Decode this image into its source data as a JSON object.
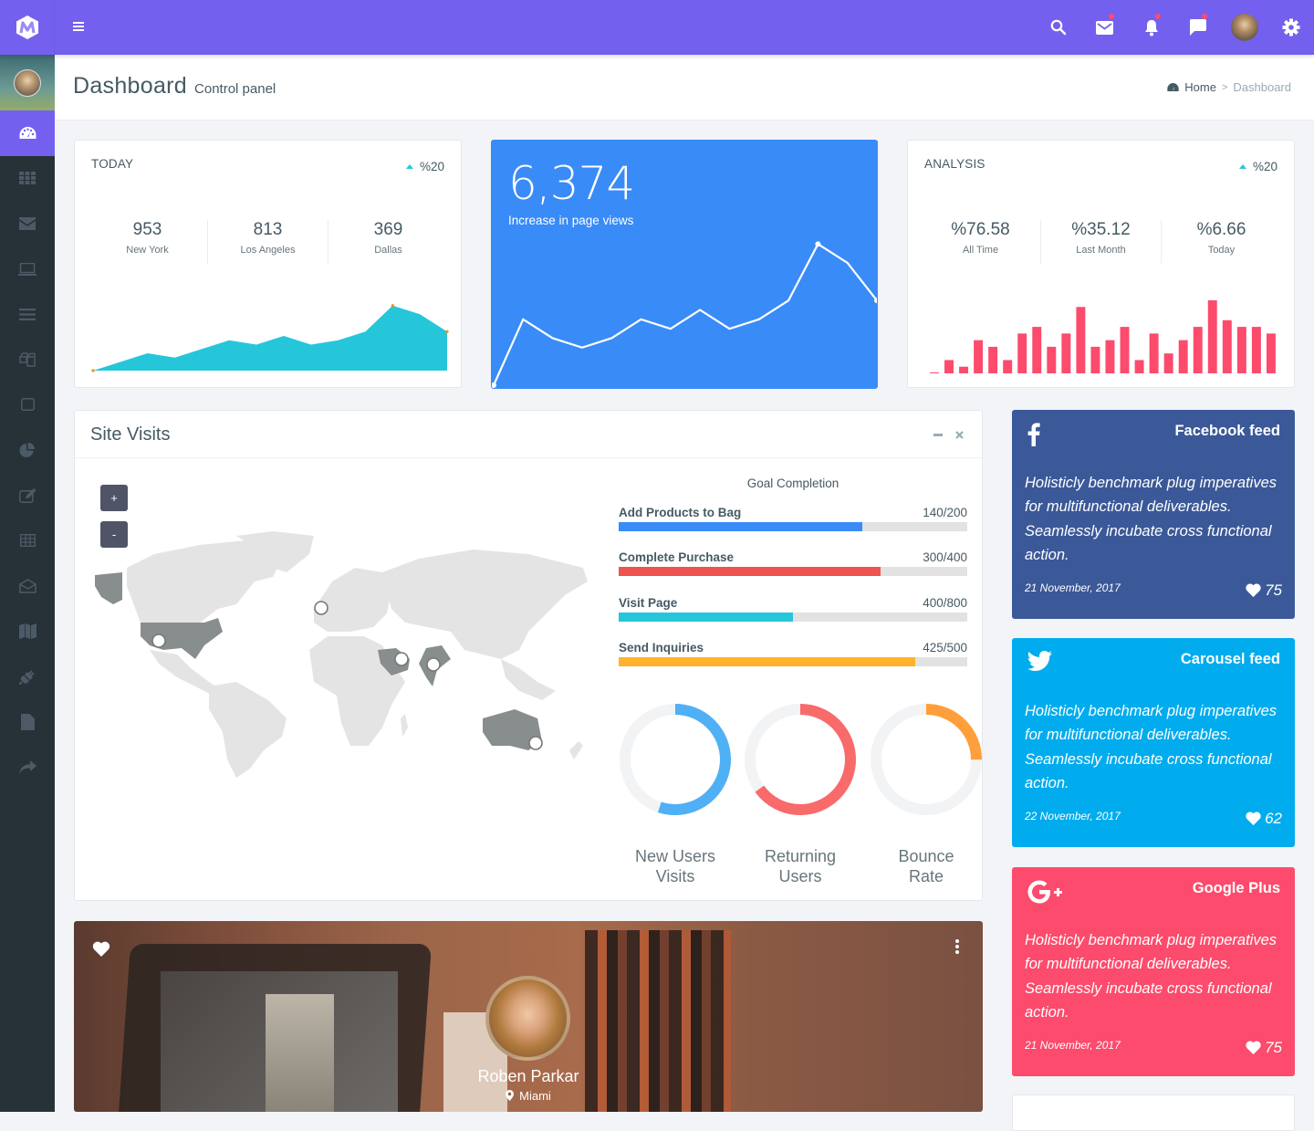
{
  "topbar": {
    "icons": [
      "logo-icon",
      "menu-icon",
      "search-icon",
      "mail-icon",
      "bell-icon",
      "chat-icon",
      "user-avatar",
      "gear-icon"
    ],
    "accent": "#7460ee",
    "badge_color": "#fc4b6c"
  },
  "sidebar": {
    "items": [
      {
        "icon": "dashboard-icon",
        "active": true
      },
      {
        "icon": "apps-grid-icon"
      },
      {
        "icon": "envelope-icon"
      },
      {
        "icon": "laptop-icon"
      },
      {
        "icon": "list-icon"
      },
      {
        "icon": "copy-icon"
      },
      {
        "icon": "square-icon"
      },
      {
        "icon": "pie-chart-icon"
      },
      {
        "icon": "edit-icon"
      },
      {
        "icon": "table-icon"
      },
      {
        "icon": "envelope-open-icon"
      },
      {
        "icon": "map-icon"
      },
      {
        "icon": "plug-icon"
      },
      {
        "icon": "file-icon"
      },
      {
        "icon": "share-icon"
      }
    ]
  },
  "header": {
    "title": "Dashboard",
    "subtitle": "Control panel",
    "breadcrumb": {
      "home": "Home",
      "separator": ">",
      "current": "Dashboard"
    }
  },
  "today_card": {
    "title": "TODAY",
    "trend": "%20",
    "stats": [
      {
        "value": "953",
        "label": "New York"
      },
      {
        "value": "813",
        "label": "Los Angeles"
      },
      {
        "value": "369",
        "label": "Dallas"
      }
    ]
  },
  "pageviews_card": {
    "value": "6,374",
    "label": "Increase in page views"
  },
  "analysis_card": {
    "title": "ANALYSIS",
    "trend": "%20",
    "stats": [
      {
        "value": "%76.58",
        "label": "All Time"
      },
      {
        "value": "%35.12",
        "label": "Last Month"
      },
      {
        "value": "%6.66",
        "label": "Today"
      }
    ]
  },
  "site_visits": {
    "title": "Site Visits",
    "zoom_in": "+",
    "zoom_out": "-",
    "goal_title": "Goal Completion",
    "goals": [
      {
        "label": "Add Products to Bag",
        "value": "140/200",
        "pct": 70,
        "color": "#398bf7"
      },
      {
        "label": "Complete Purchase",
        "value": "300/400",
        "pct": 75,
        "color": "#ef5350"
      },
      {
        "label": "Visit Page",
        "value": "400/800",
        "pct": 50,
        "color": "#26c6da"
      },
      {
        "label": "Send Inquiries",
        "value": "425/500",
        "pct": 85,
        "color": "#ffb22b"
      }
    ],
    "donuts": [
      {
        "line1": "New Users",
        "line2": "Visits",
        "pct": 55,
        "color": "#4fb0f5"
      },
      {
        "line1": "Returning",
        "line2": "Users",
        "pct": 65,
        "color": "#f96a6a"
      },
      {
        "line1": "Bounce",
        "line2": "Rate",
        "pct": 25,
        "color": "#ff9f3b"
      }
    ],
    "map_highlight": [
      "United States",
      "Saudi Arabia",
      "India",
      "Australia"
    ]
  },
  "feeds": [
    {
      "title": "Facebook feed",
      "icon": "facebook-icon",
      "text": "Holisticly benchmark plug imperatives for multifunctional deliverables. Seamlessly incubate cross functional action.",
      "date": "21 November, 2017",
      "likes": "75",
      "color": "#3b5998"
    },
    {
      "title": "Carousel feed",
      "icon": "twitter-icon",
      "text": "Holisticly benchmark plug imperatives for multifunctional deliverables. Seamlessly incubate cross functional action.",
      "date": "22 November, 2017",
      "likes": "62",
      "color": "#00aced"
    },
    {
      "title": "Google Plus",
      "icon": "google-plus-icon",
      "text": "Holisticly benchmark plug imperatives for multifunctional deliverables. Seamlessly incubate cross functional action.",
      "date": "21 November, 2017",
      "likes": "75",
      "color": "#fc4b6c"
    }
  ],
  "profile": {
    "name": "Roben Parkar",
    "location": "Miami"
  },
  "chart_data": [
    {
      "type": "area",
      "title": "TODAY",
      "x": [
        1,
        2,
        3,
        4,
        5,
        6,
        7,
        8,
        9,
        10,
        11,
        12,
        13,
        14
      ],
      "values": [
        0,
        2,
        4,
        3,
        5,
        7,
        6,
        8,
        6,
        7,
        9,
        15,
        13,
        9
      ],
      "color": "#26c6da",
      "ylim": [
        0,
        16
      ]
    },
    {
      "type": "line",
      "title": "Increase in page views",
      "x": [
        1,
        2,
        3,
        4,
        5,
        6,
        7,
        8,
        9,
        10,
        11,
        12,
        13,
        14
      ],
      "values": [
        0,
        7,
        5,
        4,
        5,
        7,
        6,
        8,
        6,
        7,
        9,
        15,
        13,
        9
      ],
      "color": "#ffffff",
      "ylim": [
        0,
        16
      ]
    },
    {
      "type": "bar",
      "title": "ANALYSIS",
      "values": [
        0,
        2,
        1,
        5,
        4,
        2,
        6,
        7,
        4,
        6,
        10,
        4,
        5,
        7,
        2,
        6,
        3,
        5,
        7,
        11,
        8,
        7,
        7,
        6
      ],
      "color": "#fc4b6c",
      "ylim": [
        0,
        11
      ]
    }
  ]
}
